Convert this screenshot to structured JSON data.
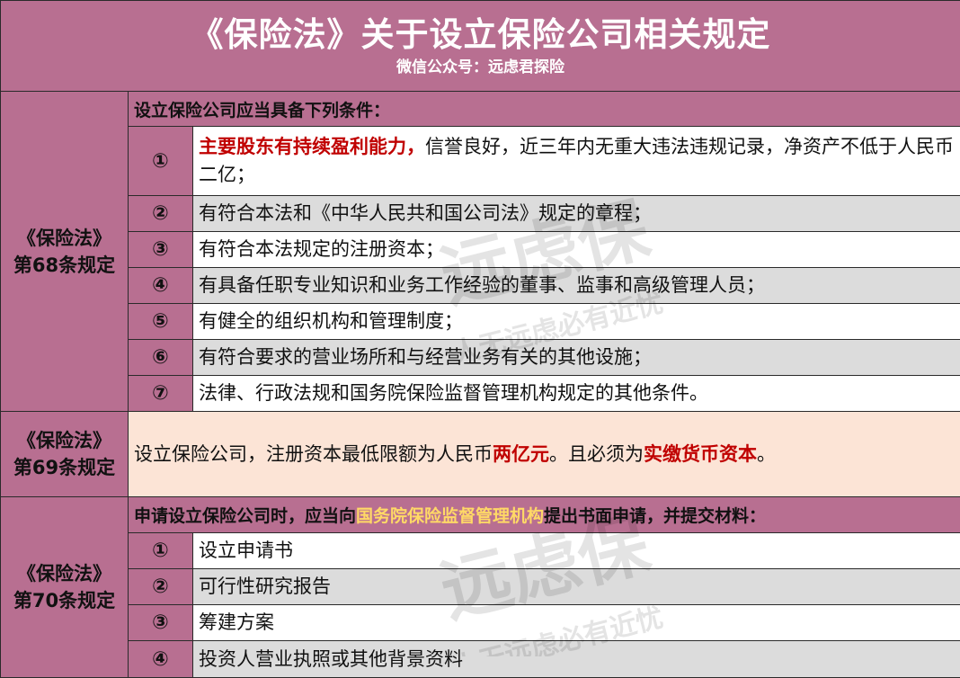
{
  "header": {
    "title": "《保险法》关于设立保险公司相关规定",
    "subtitle": "微信公众号：远虑君探险"
  },
  "art68": {
    "label_line1": "《保险法》",
    "label_line2": "第68条规定",
    "heading": "设立保险公司应当具备下列条件：",
    "items": [
      {
        "num": "①",
        "highlight": "主要股东有持续盈利能力，",
        "text": "信誉良好，近三年内无重大违法违规记录，净资产不低于人民币二亿；"
      },
      {
        "num": "②",
        "text": "有符合本法和《中华人民共和国公司法》规定的章程；"
      },
      {
        "num": "③",
        "text": "有符合本法规定的注册资本；"
      },
      {
        "num": "④",
        "text": "有具备任职专业知识和业务工作经验的董事、监事和高级管理人员；"
      },
      {
        "num": "⑤",
        "text": "有健全的组织机构和管理制度；"
      },
      {
        "num": "⑥",
        "text": "有符合要求的营业场所和与经营业务有关的其他设施；"
      },
      {
        "num": "⑦",
        "text": "法律、行政法规和国务院保险监督管理机构规定的其他条件。"
      }
    ]
  },
  "art69": {
    "label_line1": "《保险法》",
    "label_line2": "第69条规定",
    "text_a": "设立保险公司，注册资本最低限额为人民币",
    "hl_a": "两亿元",
    "text_b": "。且必须为",
    "hl_b": "实缴货币资本",
    "text_c": "。"
  },
  "art70": {
    "label_line1": "《保险法》",
    "label_line2": "第70条规定",
    "heading_a": "申请设立保险公司时，应当向",
    "heading_hl": "国务院保险监督管理机构",
    "heading_b": "提出书面申请，并提交材料：",
    "items": [
      {
        "num": "①",
        "text": "设立申请书"
      },
      {
        "num": "②",
        "text": "可行性研究报告"
      },
      {
        "num": "③",
        "text": "筹建方案"
      },
      {
        "num": "④",
        "text": "投资人营业执照或其他背景资料"
      }
    ]
  },
  "watermark": {
    "logo_text": "远虑保",
    "slogan": "人无远虑必有近忧"
  },
  "colors": {
    "header_bg": "#b86f91",
    "gray_row": "#dcdcdc",
    "peach_row": "#fce4d6",
    "highlight_red": "#c00000",
    "highlight_gold": "#ffd966"
  }
}
